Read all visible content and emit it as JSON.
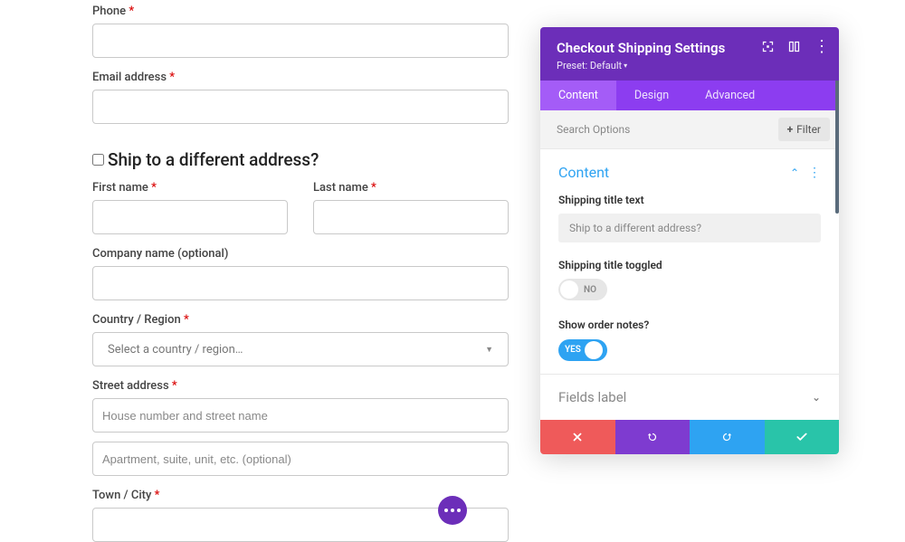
{
  "required_mark": "*",
  "form": {
    "phone": {
      "label": "Phone",
      "required": true
    },
    "email": {
      "label": "Email address",
      "required": true
    },
    "ship_different": {
      "label": "Ship to a different address?"
    },
    "first_name": {
      "label": "First name",
      "required": true
    },
    "last_name": {
      "label": "Last name",
      "required": true
    },
    "company": {
      "label": "Company name (optional)",
      "required": false
    },
    "country": {
      "label": "Country / Region",
      "required": true,
      "placeholder": "Select a country / region…"
    },
    "street": {
      "label": "Street address",
      "required": true,
      "placeholder1": "House number and street name",
      "placeholder2": "Apartment, suite, unit, etc. (optional)"
    },
    "town": {
      "label": "Town / City",
      "required": true
    }
  },
  "panel": {
    "title": "Checkout Shipping Settings",
    "preset_label": "Preset:",
    "preset_value": "Default",
    "tabs": {
      "content": "Content",
      "design": "Design",
      "advanced": "Advanced",
      "active": "content"
    },
    "search_placeholder": "Search Options",
    "filter_label": "Filter",
    "content_section": {
      "title": "Content",
      "shipping_title_text": {
        "label": "Shipping title text",
        "placeholder": "Ship to a different address?"
      },
      "shipping_title_toggled": {
        "label": "Shipping title toggled",
        "value": "NO"
      },
      "show_order_notes": {
        "label": "Show order notes?",
        "value": "YES"
      }
    },
    "fields_label_section": {
      "title": "Fields label"
    }
  }
}
